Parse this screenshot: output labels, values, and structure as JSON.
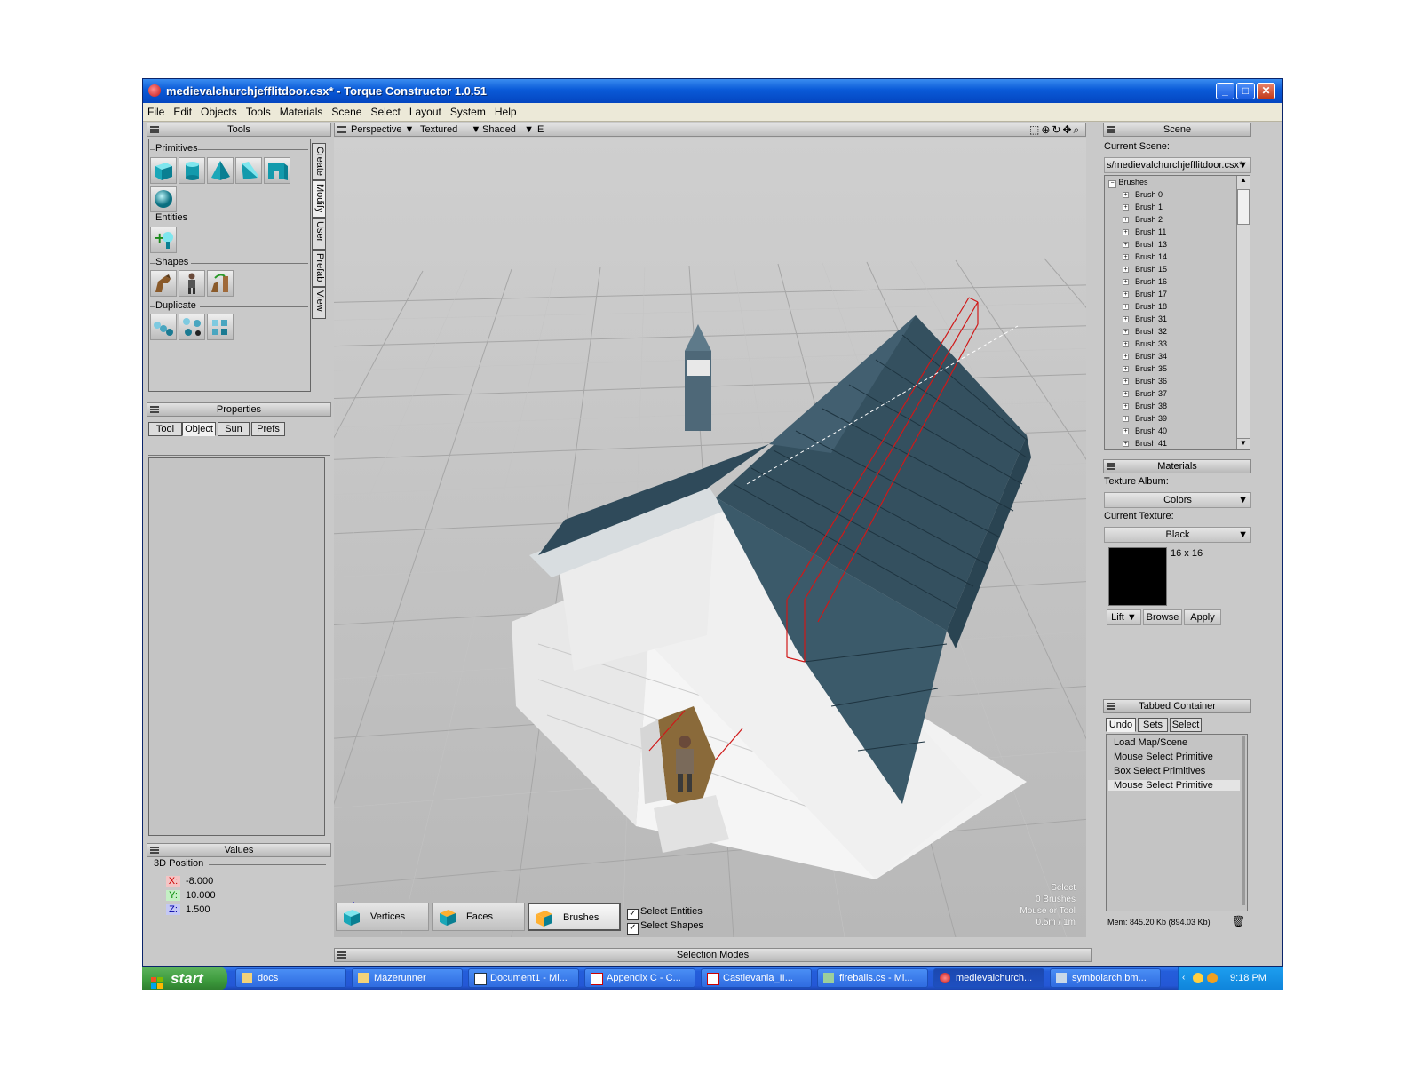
{
  "window": {
    "title": "medievalchurchjefflitdoor.csx* - Torque Constructor 1.0.51",
    "min_label": "_",
    "max_label": "□",
    "close_label": "✕"
  },
  "menu": [
    "File",
    "Edit",
    "Objects",
    "Tools",
    "Materials",
    "Scene",
    "Select",
    "Layout",
    "System",
    "Help"
  ],
  "tools_panel": {
    "title": "Tools",
    "primitives_label": "Primitives",
    "entities_label": "Entities",
    "shapes_label": "Shapes",
    "duplicate_label": "Duplicate",
    "side_tabs": [
      "Create",
      "Modify",
      "User",
      "Prefab",
      "View"
    ]
  },
  "properties_panel": {
    "title": "Properties",
    "tabs": [
      "Tool",
      "Object",
      "Sun",
      "Prefs"
    ],
    "active_tab": "Object"
  },
  "values_panel": {
    "title": "Values",
    "group": "3D Position",
    "x_label": "X:",
    "x_value": "-8.000",
    "y_label": "Y:",
    "y_value": "10.000",
    "z_label": "Z:",
    "z_value": "1.500"
  },
  "viewport": {
    "camera": "Perspective",
    "render": "Textured",
    "shading": "Shaded",
    "extra": "E",
    "status_lines": [
      "Select",
      "0 Brushes",
      "Mouse or Tool",
      "0.5m / 1m"
    ]
  },
  "selection_modes": {
    "title": "Selection Modes",
    "vertices": "Vertices",
    "faces": "Faces",
    "brushes": "Brushes",
    "select_entities": "Select Entities",
    "select_shapes": "Select Shapes"
  },
  "scene_panel": {
    "title": "Scene",
    "current_scene_label": "Current Scene:",
    "current_scene_value": "s/medievalchurchjefflitdoor.csx*",
    "tree_root": "Brushes",
    "brushes": [
      "Brush 0",
      "Brush 1",
      "Brush 2",
      "Brush 11",
      "Brush 13",
      "Brush 14",
      "Brush 15",
      "Brush 16",
      "Brush 17",
      "Brush 18",
      "Brush 31",
      "Brush 32",
      "Brush 33",
      "Brush 34",
      "Brush 35",
      "Brush 36",
      "Brush 37",
      "Brush 38",
      "Brush 39",
      "Brush 40",
      "Brush 41"
    ]
  },
  "materials_panel": {
    "title": "Materials",
    "album_label": "Texture Album:",
    "album_value": "Colors",
    "current_texture_label": "Current Texture:",
    "current_texture_value": "Black",
    "texture_size": "16 x 16",
    "lift": "Lift",
    "browse": "Browse",
    "apply": "Apply",
    "swatch_color": "#000000"
  },
  "tabbed_container": {
    "title": "Tabbed Container",
    "tabs": [
      "Undo",
      "Sets",
      "Select"
    ],
    "history": [
      "Load Map/Scene",
      "Mouse Select Primitive",
      "Box Select Primitives",
      "Mouse Select Primitive"
    ],
    "memory": "Mem: 845.20 Kb (894.03 Kb)"
  },
  "taskbar": {
    "start": "start",
    "tasks": [
      "docs",
      "Mazerunner",
      "Document1 - Mi...",
      "Appendix C - C...",
      "Castlevania_II...",
      "fireballs.cs - Mi...",
      "medievalchurch...",
      "symbolarch.bm..."
    ],
    "active_task": "medievalchurch...",
    "clock": "9:18 PM"
  }
}
